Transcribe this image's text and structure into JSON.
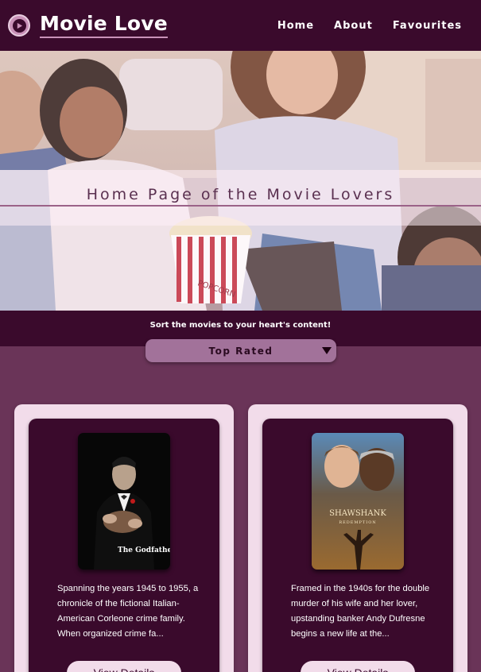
{
  "header": {
    "brand": "Movie Love",
    "logo_icon": "play-icon",
    "nav": [
      "Home",
      "About",
      "Favourites"
    ]
  },
  "hero": {
    "title": "Home Page of the Movie Lovers",
    "popcorn_label": "POPCORN"
  },
  "sort": {
    "label": "Sort the movies to your heart's content!",
    "selected": "Top Rated",
    "caret_icon": "chevron-down-icon"
  },
  "movies": [
    {
      "poster_title": "The Godfather",
      "description": "Spanning the years 1945 to 1955, a chronicle of the fictional Italian-American Corleone crime family. When organized crime fa...",
      "button": "View Details"
    },
    {
      "poster_title": "SHAWSHANK",
      "poster_subtitle": "REDEMPTION",
      "description": "Framed in the 1940s for the double murder of his wife and her lover, upstanding banker Andy Dufresne begins a new life at the...",
      "button": "View Details"
    }
  ],
  "colors": {
    "primary_dark": "#3a0a2c",
    "page_bg": "#6a3458",
    "card_light": "#f2dcea",
    "accent": "#a2729a"
  }
}
